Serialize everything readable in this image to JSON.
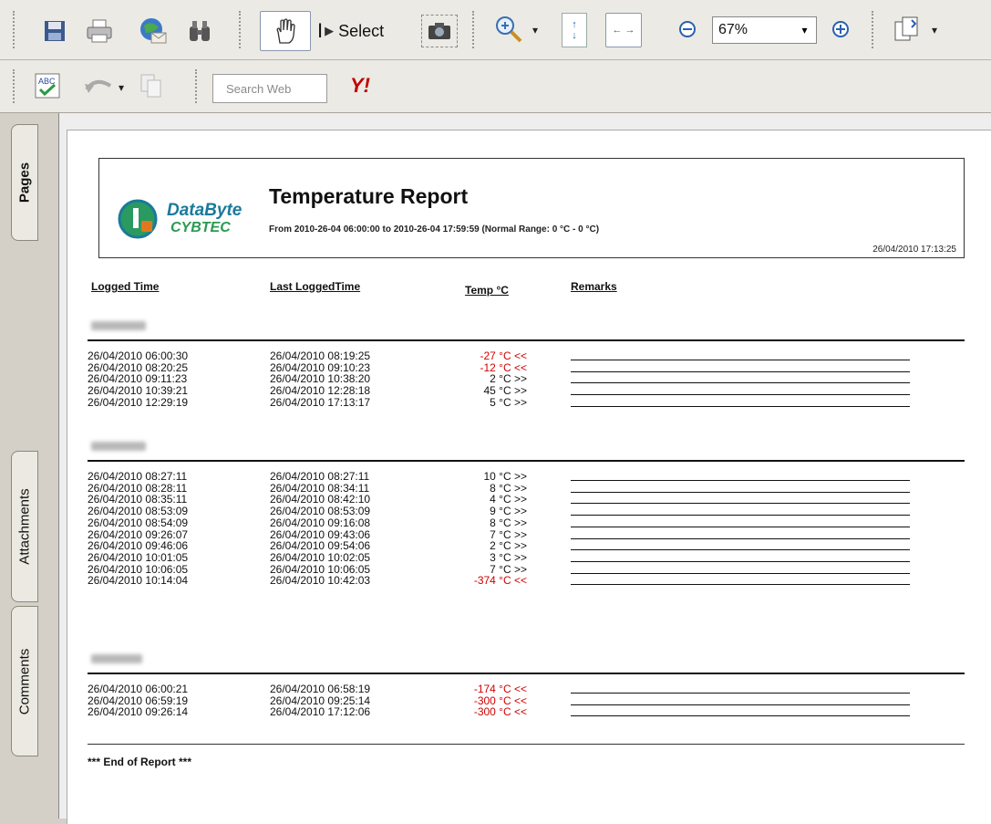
{
  "toolbar": {
    "select_label": "Select",
    "zoom_value": "67%",
    "search_placeholder": "Search Web",
    "yahoo_label": "Y!"
  },
  "sidebar": {
    "tabs": [
      {
        "label": "Pages"
      },
      {
        "label": "Attachments"
      },
      {
        "label": "Comments"
      }
    ]
  },
  "report": {
    "logo_line1": "DataByte",
    "logo_line2": "CYBTEC",
    "title": "Temperature Report",
    "subtitle": "From 2010-26-04  06:00:00 to 2010-26-04  17:59:59 (Normal Range: 0 °C - 0 °C)",
    "generated": "26/04/2010  17:13:25",
    "columns": [
      "Logged Time",
      "Last LoggedTime",
      "Temp °C",
      "Remarks"
    ],
    "groups": [
      {
        "rows": [
          {
            "logged": "26/04/2010 06:00:30",
            "last": "26/04/2010 08:19:25",
            "temp": "-27 °C <<",
            "cold": true
          },
          {
            "logged": "26/04/2010 08:20:25",
            "last": "26/04/2010 09:10:23",
            "temp": "-12 °C <<",
            "cold": true
          },
          {
            "logged": "26/04/2010 09:11:23",
            "last": "26/04/2010 10:38:20",
            "temp": "2 °C >>",
            "cold": false
          },
          {
            "logged": "26/04/2010 10:39:21",
            "last": "26/04/2010 12:28:18",
            "temp": "45 °C >>",
            "cold": false
          },
          {
            "logged": "26/04/2010 12:29:19",
            "last": "26/04/2010 17:13:17",
            "temp": "5 °C >>",
            "cold": false
          }
        ]
      },
      {
        "rows": [
          {
            "logged": "26/04/2010 08:27:11",
            "last": "26/04/2010 08:27:11",
            "temp": "10 °C >>",
            "cold": false
          },
          {
            "logged": "26/04/2010 08:28:11",
            "last": "26/04/2010 08:34:11",
            "temp": "8 °C >>",
            "cold": false
          },
          {
            "logged": "26/04/2010 08:35:11",
            "last": "26/04/2010 08:42:10",
            "temp": "4 °C >>",
            "cold": false
          },
          {
            "logged": "26/04/2010 08:53:09",
            "last": "26/04/2010 08:53:09",
            "temp": "9 °C >>",
            "cold": false
          },
          {
            "logged": "26/04/2010 08:54:09",
            "last": "26/04/2010 09:16:08",
            "temp": "8 °C >>",
            "cold": false
          },
          {
            "logged": "26/04/2010 09:26:07",
            "last": "26/04/2010 09:43:06",
            "temp": "7 °C >>",
            "cold": false
          },
          {
            "logged": "26/04/2010 09:46:06",
            "last": "26/04/2010 09:54:06",
            "temp": "2 °C >>",
            "cold": false
          },
          {
            "logged": "26/04/2010 10:01:05",
            "last": "26/04/2010 10:02:05",
            "temp": "3 °C >>",
            "cold": false
          },
          {
            "logged": "26/04/2010 10:06:05",
            "last": "26/04/2010 10:06:05",
            "temp": "7 °C >>",
            "cold": false
          },
          {
            "logged": "26/04/2010 10:14:04",
            "last": "26/04/2010 10:42:03",
            "temp": "-374 °C <<",
            "cold": true
          }
        ]
      },
      {
        "rows": [
          {
            "logged": "26/04/2010 06:00:21",
            "last": "26/04/2010 06:58:19",
            "temp": "-174 °C <<",
            "cold": true
          },
          {
            "logged": "26/04/2010 06:59:19",
            "last": "26/04/2010 09:25:14",
            "temp": "-300 °C <<",
            "cold": true
          },
          {
            "logged": "26/04/2010 09:26:14",
            "last": "26/04/2010 17:12:06",
            "temp": "-300 °C <<",
            "cold": true
          }
        ]
      }
    ],
    "end_text": "*** End of Report ***"
  }
}
